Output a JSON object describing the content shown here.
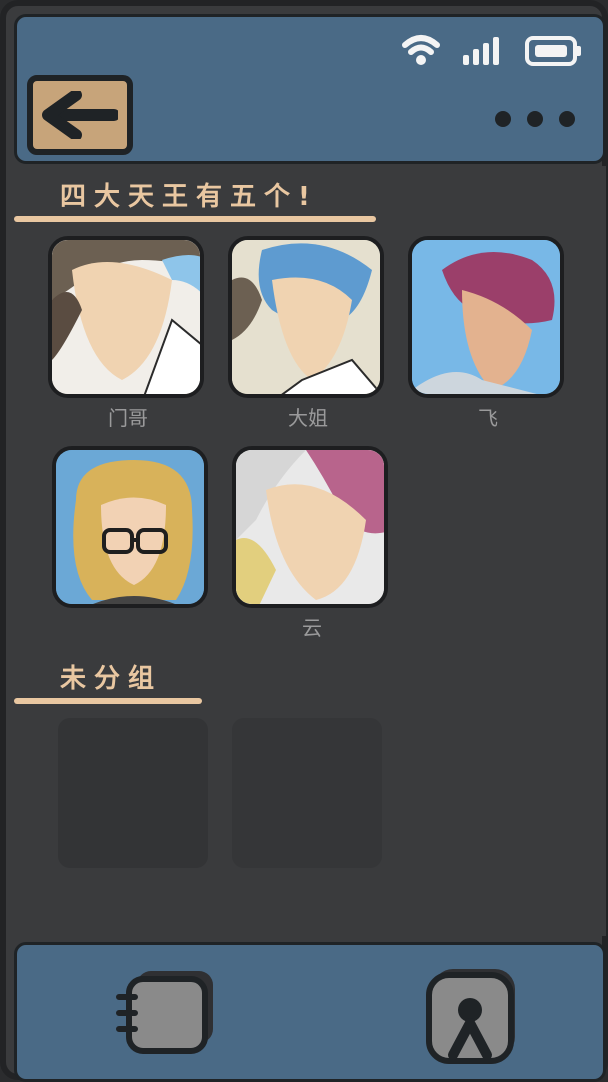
{
  "header": {
    "back_label": "←"
  },
  "sections": [
    {
      "title": "四大天王有五个!",
      "members": [
        {
          "name": "门哥"
        },
        {
          "name": "大姐"
        },
        {
          "name": "飞"
        },
        {
          "name": ""
        },
        {
          "name": "云"
        }
      ]
    },
    {
      "title": "未分组",
      "members": []
    }
  ],
  "colors": {
    "accent": "#e9c7a1",
    "bar_blue": "#4a6a86",
    "back_button": "#c7a47a"
  }
}
